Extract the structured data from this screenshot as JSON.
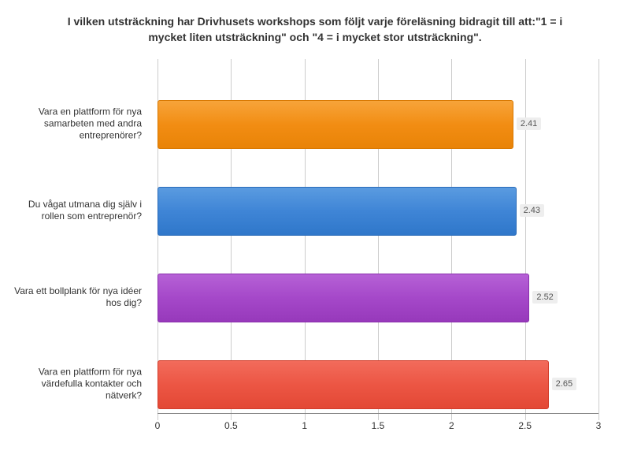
{
  "chart_data": {
    "type": "bar",
    "orientation": "horizontal",
    "title": "I vilken utsträckning har Drivhusets workshops som följt varje föreläsning bidragit till att:\"1 = i mycket liten utsträckning\" och \"4 = i mycket stor utsträckning\".",
    "categories": [
      "Vara en plattform för nya samarbeten med andra entreprenörer?",
      "Du vågat utmana dig själv i rollen som entreprenör?",
      "Vara ett bollplank för nya idéer hos dig?",
      "Vara en plattform för nya värdefulla kontakter och nätverk?"
    ],
    "values": [
      2.41,
      2.43,
      2.52,
      2.65
    ],
    "colors": [
      "#f28d13",
      "#3f85d6",
      "#a548c9",
      "#ec5644"
    ],
    "xlabel": "",
    "ylabel": "",
    "xlim": [
      0,
      3
    ],
    "xticks": [
      0,
      0.5,
      1,
      1.5,
      2,
      2.5,
      3
    ]
  }
}
